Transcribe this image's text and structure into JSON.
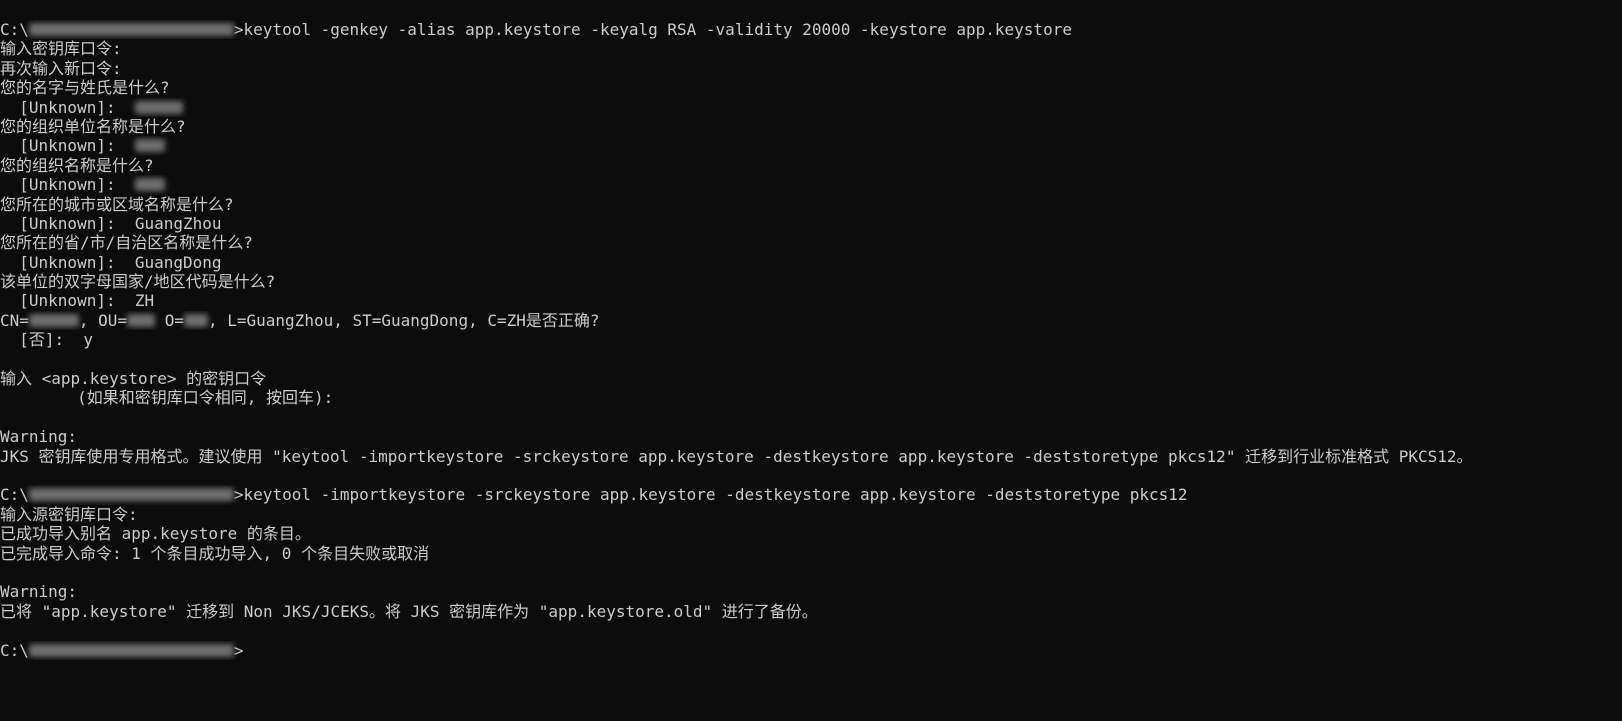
{
  "terminal": {
    "lines": [
      {
        "segments": [
          "C:\\",
          "",
          ">keytool -genkey -alias app.keystore -keyalg RSA -validity 20000 -keystore app.keystore"
        ]
      },
      {
        "segments": [
          "输入密钥库口令:"
        ]
      },
      {
        "segments": [
          "再次输入新口令:"
        ]
      },
      {
        "segments": [
          "您的名字与姓氏是什么?"
        ]
      },
      {
        "segments": [
          "  [Unknown]:  ",
          ""
        ]
      },
      {
        "segments": [
          "您的组织单位名称是什么?"
        ]
      },
      {
        "segments": [
          "  [Unknown]:  ",
          ""
        ]
      },
      {
        "segments": [
          "您的组织名称是什么?"
        ]
      },
      {
        "segments": [
          "  [Unknown]:  ",
          ""
        ]
      },
      {
        "segments": [
          "您所在的城市或区域名称是什么?"
        ]
      },
      {
        "segments": [
          "  [Unknown]:  GuangZhou"
        ]
      },
      {
        "segments": [
          "您所在的省/市/自治区名称是什么?"
        ]
      },
      {
        "segments": [
          "  [Unknown]:  GuangDong"
        ]
      },
      {
        "segments": [
          "该单位的双字母国家/地区代码是什么?"
        ]
      },
      {
        "segments": [
          "  [Unknown]:  ZH"
        ]
      },
      {
        "segments": [
          "CN=",
          "",
          ", OU=",
          "",
          " O=",
          "",
          ", L=GuangZhou, ST=GuangDong, C=ZH是否正确?"
        ]
      },
      {
        "segments": [
          "  [否]:  y"
        ]
      },
      {
        "segments": [
          ""
        ]
      },
      {
        "segments": [
          "输入 <app.keystore> 的密钥口令"
        ]
      },
      {
        "segments": [
          "        (如果和密钥库口令相同, 按回车):"
        ]
      },
      {
        "segments": [
          ""
        ]
      },
      {
        "segments": [
          "Warning:"
        ]
      },
      {
        "segments": [
          "JKS 密钥库使用专用格式。建议使用 \"keytool -importkeystore -srckeystore app.keystore -destkeystore app.keystore -deststoretype pkcs12\" 迁移到行业标准格式 PKCS12。"
        ]
      },
      {
        "segments": [
          ""
        ]
      },
      {
        "segments": [
          "C:\\",
          "",
          ">keytool -importkeystore -srckeystore app.keystore -destkeystore app.keystore -deststoretype pkcs12"
        ]
      },
      {
        "segments": [
          "输入源密钥库口令:"
        ]
      },
      {
        "segments": [
          "已成功导入别名 app.keystore 的条目。"
        ]
      },
      {
        "segments": [
          "已完成导入命令: 1 个条目成功导入, 0 个条目失败或取消"
        ]
      },
      {
        "segments": [
          ""
        ]
      },
      {
        "segments": [
          "Warning:"
        ]
      },
      {
        "segments": [
          "已将 \"app.keystore\" 迁移到 Non JKS/JCEKS。将 JKS 密钥库作为 \"app.keystore.old\" 进行了备份。"
        ]
      },
      {
        "segments": [
          ""
        ]
      },
      {
        "segments": [
          "C:\\",
          "",
          ">"
        ]
      }
    ]
  }
}
